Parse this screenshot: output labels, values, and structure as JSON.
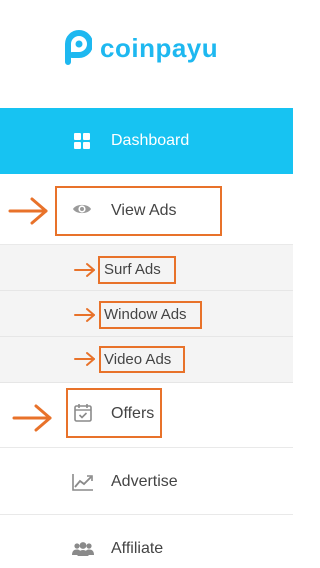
{
  "brand": {
    "name": "coinpayu",
    "color": "#1eb8f0"
  },
  "menu": {
    "dashboard": {
      "label": "Dashboard",
      "icon": "grid-icon",
      "active_color": "#17c3f2"
    },
    "view_ads": {
      "label": "View Ads",
      "icon": "eye-icon",
      "submenu": [
        {
          "label": "Surf Ads"
        },
        {
          "label": "Window Ads"
        },
        {
          "label": "Video Ads"
        }
      ]
    },
    "offers": {
      "label": "Offers",
      "icon": "calendar-check-icon"
    },
    "advertise": {
      "label": "Advertise",
      "icon": "chart-line-icon"
    },
    "affiliate": {
      "label": "Affiliate",
      "icon": "users-icon"
    }
  },
  "annotation_color": "#e8722a"
}
